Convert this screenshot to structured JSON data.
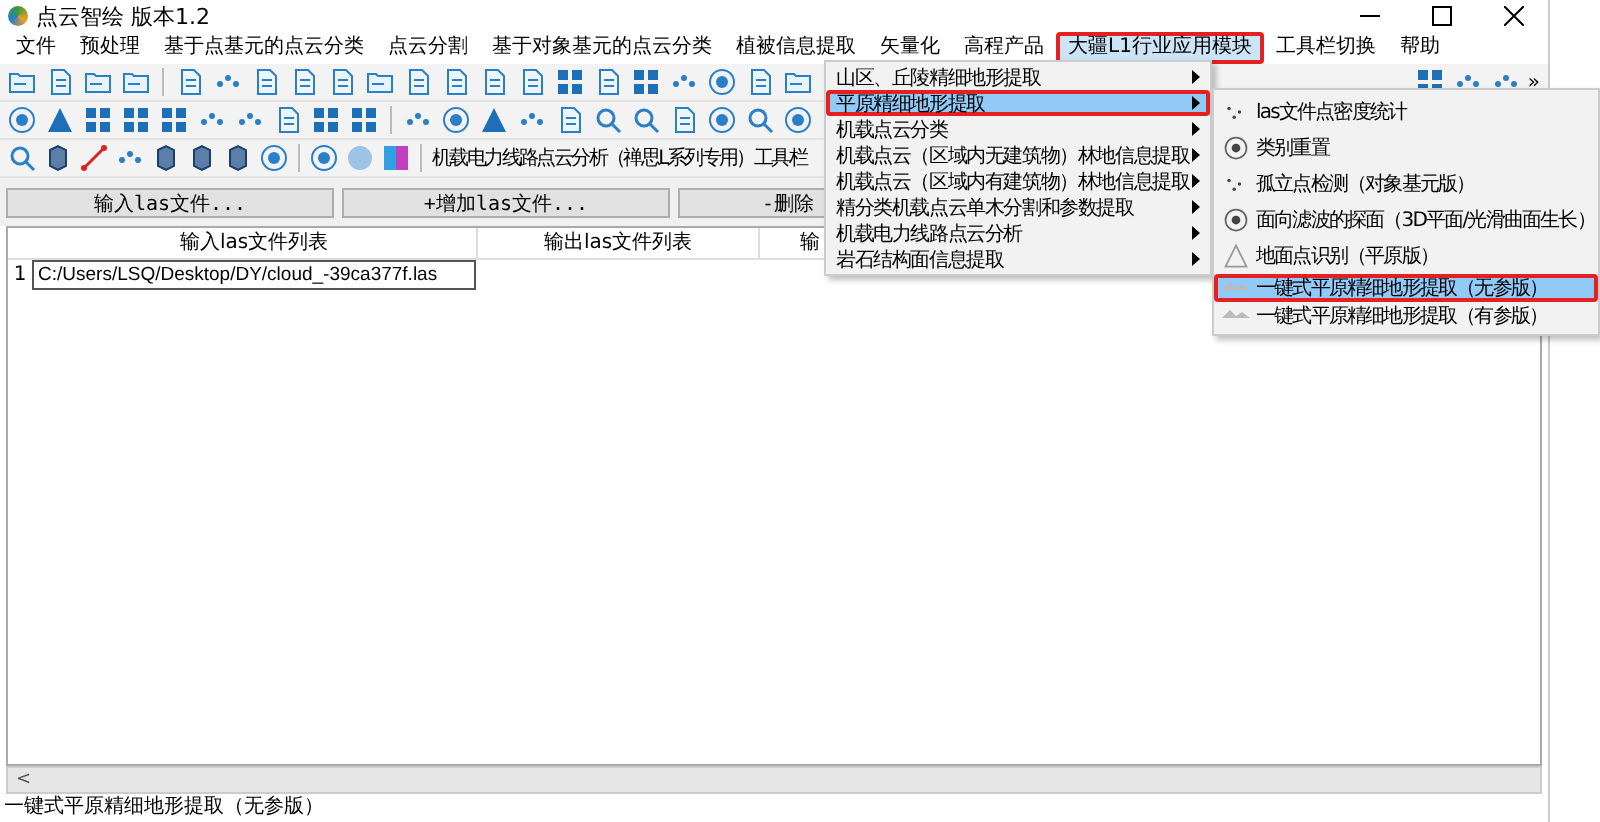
{
  "window": {
    "title": "点云智绘 版本1.2"
  },
  "menu_bar": [
    {
      "label": "文件",
      "selected": false,
      "highlight": false
    },
    {
      "label": "预处理",
      "selected": false,
      "highlight": false
    },
    {
      "label": "基于点基元的点云分类",
      "selected": false,
      "highlight": false
    },
    {
      "label": "点云分割",
      "selected": false,
      "highlight": false
    },
    {
      "label": "基于对象基元的点云分类",
      "selected": false,
      "highlight": false
    },
    {
      "label": "植被信息提取",
      "selected": false,
      "highlight": false
    },
    {
      "label": "矢量化",
      "selected": false,
      "highlight": false
    },
    {
      "label": "高程产品",
      "selected": false,
      "highlight": false
    },
    {
      "label": "大疆L1行业应用模块",
      "selected": true,
      "highlight": true
    },
    {
      "label": "工具栏切换",
      "selected": false,
      "highlight": false
    },
    {
      "label": "帮助",
      "selected": false,
      "highlight": false
    }
  ],
  "toolbar": {
    "label": "机载电力线路点云分析（禅思L系列专用）工具栏",
    "overflow": "»"
  },
  "file_buttons": [
    "输入las文件...",
    "+增加las文件...",
    "-删除"
  ],
  "table": {
    "columns": [
      "输入las文件列表",
      "输出las文件列表",
      "输"
    ],
    "rows": [
      {
        "number": "1",
        "cells": [
          "C:/Users/LSQ/Desktop/DY/cloud_-39ca377f.las"
        ],
        "editing": true
      }
    ]
  },
  "menu": {
    "items": [
      {
        "label": "山区、丘陵精细地形提取",
        "selected": false,
        "highlight": false
      },
      {
        "label": "平原精细地形提取",
        "selected": true,
        "highlight": true
      },
      {
        "label": "机载点云分类",
        "selected": false,
        "highlight": false
      },
      {
        "label": "机载点云（区域内无建筑物）林地信息提取",
        "selected": false,
        "highlight": false
      },
      {
        "label": "机载点云（区域内有建筑物）林地信息提取",
        "selected": false,
        "highlight": false
      },
      {
        "label": "精分类机载点云单木分割和参数提取",
        "selected": false,
        "highlight": false
      },
      {
        "label": "机载电力线路点云分析",
        "selected": false,
        "highlight": false
      },
      {
        "label": "岩石结构面信息提取",
        "selected": false,
        "highlight": false
      }
    ]
  },
  "submenu": {
    "items": [
      {
        "label": "las文件点密度统计",
        "selected": false,
        "highlight": false
      },
      {
        "label": "类别重置",
        "selected": false,
        "highlight": false
      },
      {
        "label": "孤立点检测（对象基元版）",
        "selected": false,
        "highlight": false
      },
      {
        "label": "面向滤波的探面（3D平面/光滑曲面生长）",
        "selected": false,
        "highlight": false
      },
      {
        "label": "地面点识别（平原版）",
        "selected": false,
        "highlight": false
      },
      {
        "label": "一键式平原精细地形提取（无参版）",
        "selected": true,
        "highlight": true
      },
      {
        "label": "一键式平原精细地形提取（有参版）",
        "selected": false,
        "highlight": false
      }
    ]
  },
  "scrollbar": {
    "arrow": "<"
  },
  "status_bar": "一键式平原精细地形提取（无参版）"
}
